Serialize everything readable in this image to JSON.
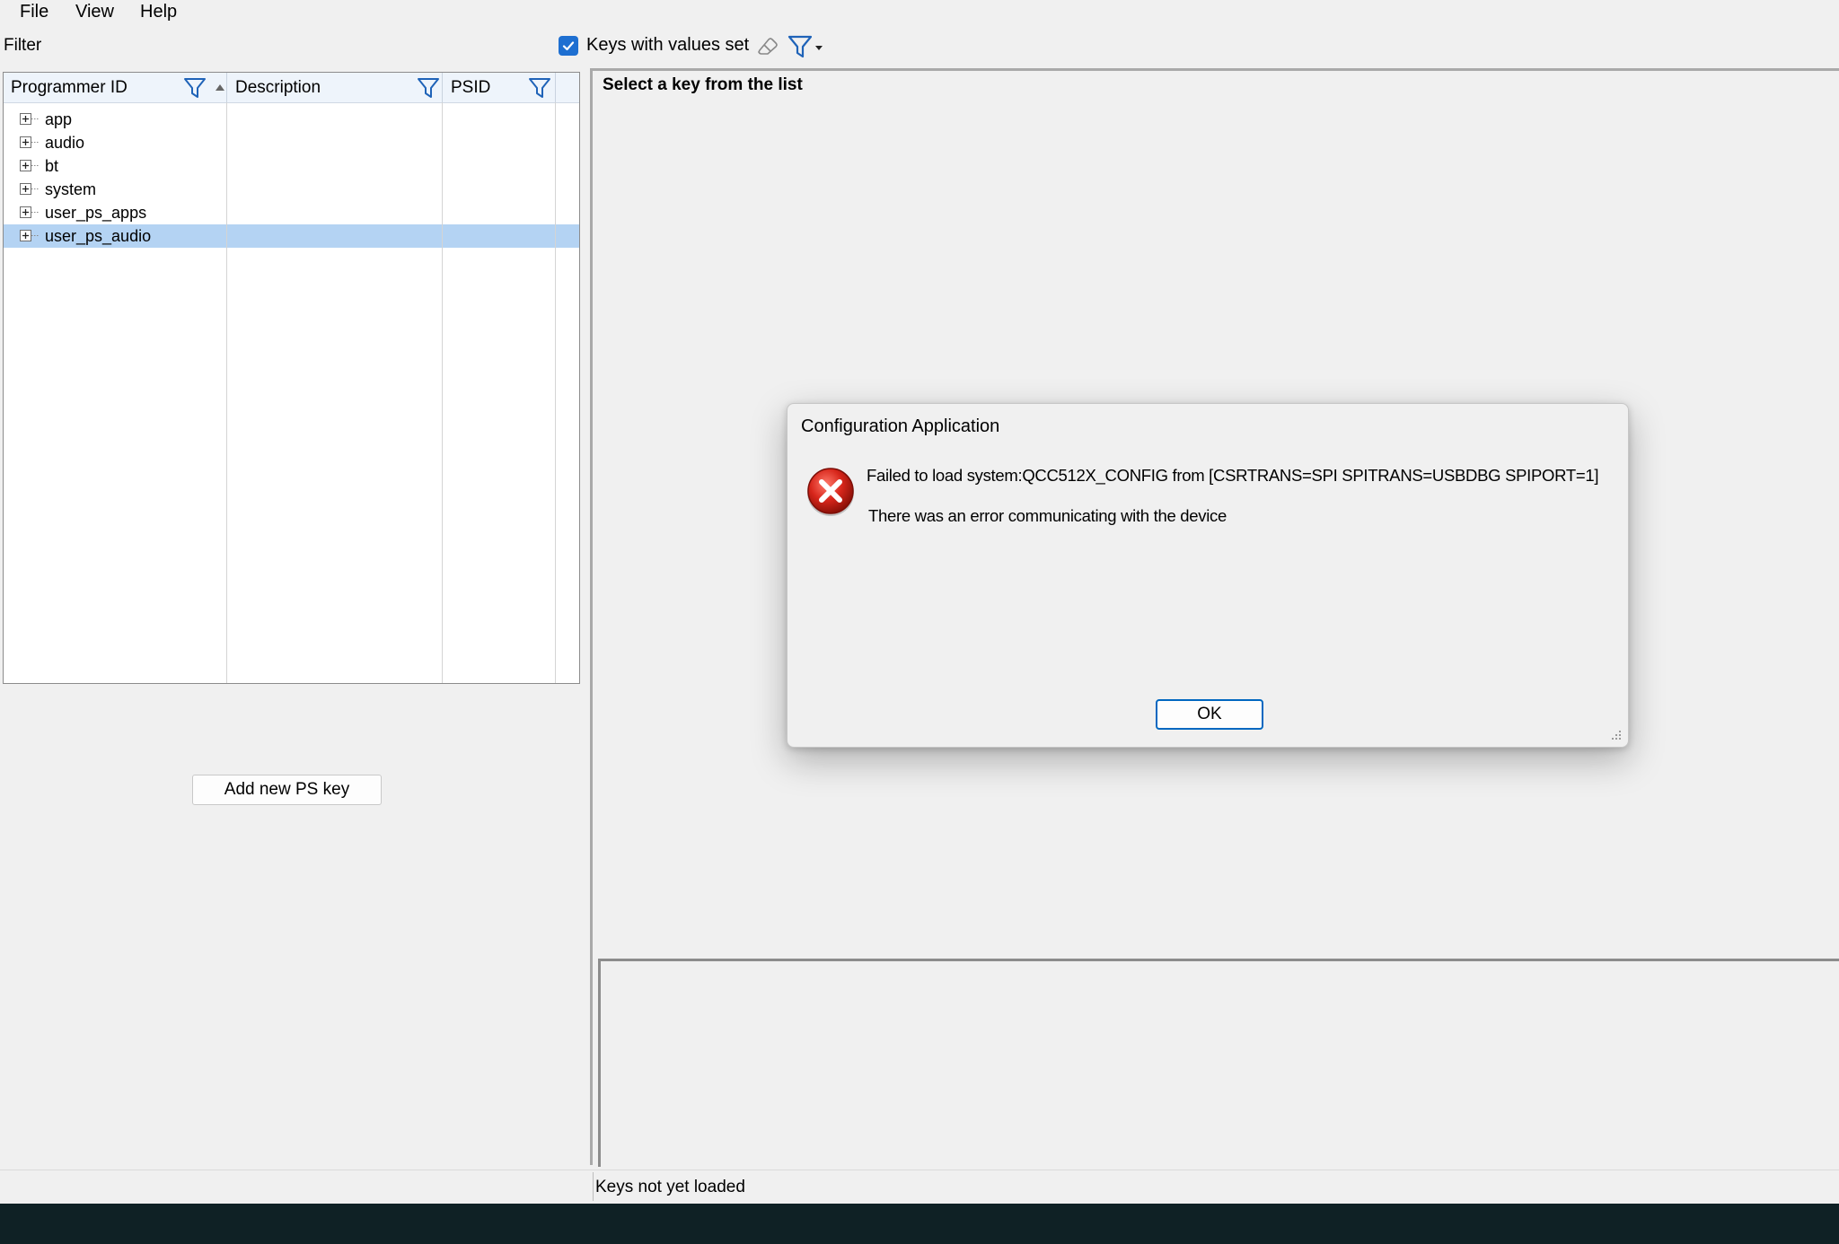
{
  "menu": {
    "file": "File",
    "view": "View",
    "help": "Help"
  },
  "filter": {
    "label": "Filter",
    "value": "",
    "keys_with_values_label": "Keys with values set",
    "keys_with_values_checked": true
  },
  "tree": {
    "columns": {
      "programmer_id": "Programmer ID",
      "description": "Description",
      "psid": "PSID"
    },
    "rows": [
      {
        "label": "app",
        "selected": false
      },
      {
        "label": "audio",
        "selected": false
      },
      {
        "label": "bt",
        "selected": false
      },
      {
        "label": "system",
        "selected": false
      },
      {
        "label": "user_ps_apps",
        "selected": false
      },
      {
        "label": "user_ps_audio",
        "selected": true
      }
    ]
  },
  "actions": {
    "add_ps_key": "Add new PS key"
  },
  "detail": {
    "prompt": "Select a key from the list"
  },
  "status": {
    "text": "Keys not yet loaded"
  },
  "dialog": {
    "title": "Configuration Application",
    "message_line1": "Failed to load system:QCC512X_CONFIG from [CSRTRANS=SPI SPITRANS=USBDBG SPIPORT=1]",
    "message_line2": "There was an error communicating with the device",
    "ok_label": "OK",
    "icon": "error-icon"
  },
  "colors": {
    "accent": "#0067c0",
    "checkbox": "#1e6fd1",
    "filter_icon": "#1f63b8",
    "selection": "#b4d3f3",
    "error_red": "#c42b1c"
  }
}
